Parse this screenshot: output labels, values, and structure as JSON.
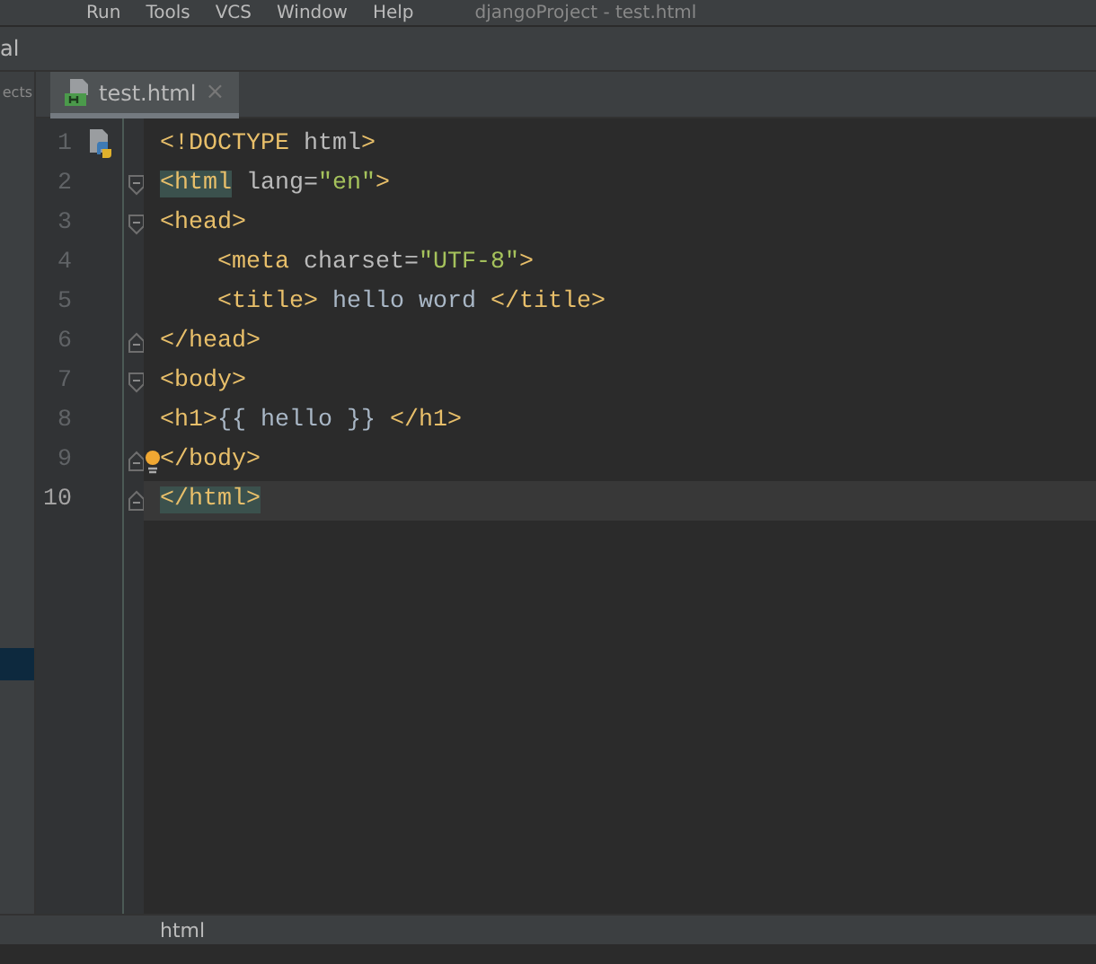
{
  "menu": [
    {
      "label": "Run"
    },
    {
      "label": "Tools"
    },
    {
      "label": "VCS"
    },
    {
      "label": "Window"
    },
    {
      "label": "Help"
    }
  ],
  "window_title": "djangoProject - test.html",
  "breadcrumb": "al",
  "project_panel": {
    "label": "ects"
  },
  "tabs": [
    {
      "label": "test.html",
      "close": "×",
      "selected": true
    }
  ],
  "editor": {
    "lines": [
      {
        "number": "1",
        "current": false,
        "kind": "plain",
        "bulb": false,
        "tokens": [
          {
            "kind": "tag",
            "text": "<!DOCTYPE"
          },
          {
            "kind": "attr",
            "text": " html"
          },
          {
            "kind": "tag",
            "text": ">"
          }
        ]
      },
      {
        "number": "2",
        "current": false,
        "kind": "fold-start",
        "bulb": false,
        "tokens": [
          {
            "kind": "tag",
            "text": "<html",
            "matched": true
          },
          {
            "kind": "attr",
            "text": " lang="
          },
          {
            "kind": "value",
            "text": "\"en\""
          },
          {
            "kind": "tag",
            "text": ">"
          }
        ]
      },
      {
        "number": "3",
        "current": false,
        "kind": "fold-start",
        "bulb": false,
        "tokens": [
          {
            "kind": "tag",
            "text": "<head>"
          }
        ]
      },
      {
        "number": "4",
        "current": false,
        "kind": "plain",
        "bulb": false,
        "tokens": [
          {
            "kind": "tag",
            "text": "    <meta"
          },
          {
            "kind": "attr",
            "text": " charset="
          },
          {
            "kind": "value",
            "text": "\"UTF-8\""
          },
          {
            "kind": "tag",
            "text": ">"
          }
        ]
      },
      {
        "number": "5",
        "current": false,
        "kind": "plain",
        "bulb": false,
        "tokens": [
          {
            "kind": "tag",
            "text": "    <title>"
          },
          {
            "kind": "text",
            "text": " hello word "
          },
          {
            "kind": "tag",
            "text": "</title>"
          }
        ]
      },
      {
        "number": "6",
        "current": false,
        "kind": "fold-end",
        "bulb": false,
        "tokens": [
          {
            "kind": "tag",
            "text": "</head>"
          }
        ]
      },
      {
        "number": "7",
        "current": false,
        "kind": "fold-start",
        "bulb": false,
        "tokens": [
          {
            "kind": "tag",
            "text": "<body>"
          }
        ]
      },
      {
        "number": "8",
        "current": false,
        "kind": "plain",
        "bulb": false,
        "tokens": [
          {
            "kind": "tag",
            "text": "<h1>"
          },
          {
            "kind": "text",
            "text": "{{ hello }} "
          },
          {
            "kind": "tag",
            "text": "</h1>"
          }
        ]
      },
      {
        "number": "9",
        "current": false,
        "kind": "fold-end",
        "bulb": true,
        "tokens": [
          {
            "kind": "tag",
            "text": "</body>"
          }
        ]
      },
      {
        "number": "10",
        "current": true,
        "kind": "fold-end",
        "bulb": false,
        "tokens": [
          {
            "kind": "tag",
            "text": "</html>",
            "matched": true
          }
        ]
      }
    ]
  },
  "status_bar": {
    "breadcrumb": "html"
  }
}
